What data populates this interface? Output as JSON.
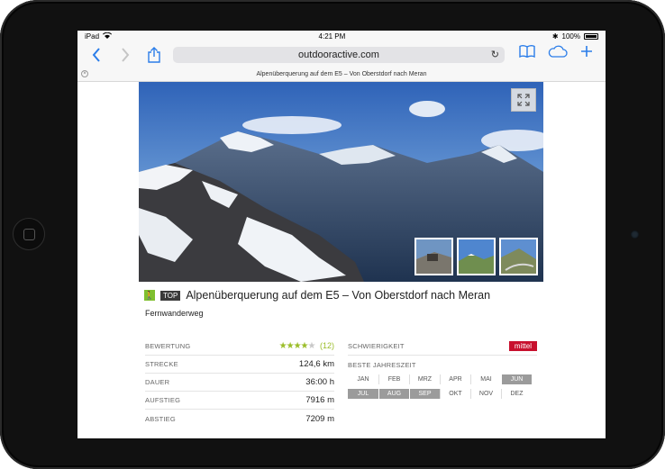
{
  "status": {
    "device": "iPad",
    "time": "4:21 PM",
    "battery": "100%"
  },
  "browser": {
    "url": "outdooractive.com",
    "page_title": "Alpenüberquerung auf dem E5 – Von Oberstdorf nach Meran"
  },
  "icons": {
    "back": "chevron-left-icon",
    "forward": "chevron-right-icon",
    "share": "share-icon",
    "reload": "reload-icon",
    "bookmarks": "book-icon",
    "icloud": "cloud-icon",
    "new_tab": "plus-icon",
    "expand": "expand-icon"
  },
  "tour": {
    "top_label": "TOP",
    "title": "Alpenüberquerung auf dem E5 – Von Oberstdorf nach Meran",
    "category": "Fernwanderweg"
  },
  "details": {
    "rating_label": "BEWERTUNG",
    "rating_stars": 4,
    "rating_count": "(12)",
    "rows": [
      {
        "label": "STRECKE",
        "value": "124,6 km"
      },
      {
        "label": "DAUER",
        "value": "36:00 h"
      },
      {
        "label": "AUFSTIEG",
        "value": "7916 m"
      },
      {
        "label": "ABSTIEG",
        "value": "7209 m"
      }
    ]
  },
  "difficulty": {
    "label": "SCHWIERIGKEIT",
    "value": "mittel",
    "color": "#c8102e"
  },
  "season": {
    "label": "BESTE JAHRESZEIT",
    "months": [
      {
        "name": "JAN",
        "active": false
      },
      {
        "name": "FEB",
        "active": false
      },
      {
        "name": "MRZ",
        "active": false
      },
      {
        "name": "APR",
        "active": false
      },
      {
        "name": "MAI",
        "active": false
      },
      {
        "name": "JUN",
        "active": true
      },
      {
        "name": "JUL",
        "active": true
      },
      {
        "name": "AUG",
        "active": true
      },
      {
        "name": "SEP",
        "active": true
      },
      {
        "name": "OKT",
        "active": false
      },
      {
        "name": "NOV",
        "active": false
      },
      {
        "name": "DEZ",
        "active": false
      }
    ]
  },
  "colors": {
    "accent": "#2b7de9",
    "rating": "#9bbd29"
  }
}
